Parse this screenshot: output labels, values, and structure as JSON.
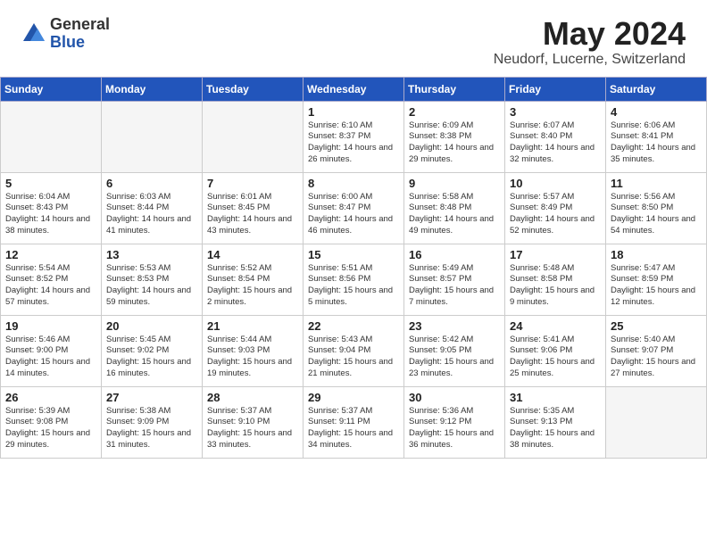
{
  "logo": {
    "general": "General",
    "blue": "Blue"
  },
  "title": {
    "month_year": "May 2024",
    "location": "Neudorf, Lucerne, Switzerland"
  },
  "weekdays": [
    "Sunday",
    "Monday",
    "Tuesday",
    "Wednesday",
    "Thursday",
    "Friday",
    "Saturday"
  ],
  "weeks": [
    [
      {
        "day": "",
        "info": ""
      },
      {
        "day": "",
        "info": ""
      },
      {
        "day": "",
        "info": ""
      },
      {
        "day": "1",
        "info": "Sunrise: 6:10 AM\nSunset: 8:37 PM\nDaylight: 14 hours\nand 26 minutes."
      },
      {
        "day": "2",
        "info": "Sunrise: 6:09 AM\nSunset: 8:38 PM\nDaylight: 14 hours\nand 29 minutes."
      },
      {
        "day": "3",
        "info": "Sunrise: 6:07 AM\nSunset: 8:40 PM\nDaylight: 14 hours\nand 32 minutes."
      },
      {
        "day": "4",
        "info": "Sunrise: 6:06 AM\nSunset: 8:41 PM\nDaylight: 14 hours\nand 35 minutes."
      }
    ],
    [
      {
        "day": "5",
        "info": "Sunrise: 6:04 AM\nSunset: 8:43 PM\nDaylight: 14 hours\nand 38 minutes."
      },
      {
        "day": "6",
        "info": "Sunrise: 6:03 AM\nSunset: 8:44 PM\nDaylight: 14 hours\nand 41 minutes."
      },
      {
        "day": "7",
        "info": "Sunrise: 6:01 AM\nSunset: 8:45 PM\nDaylight: 14 hours\nand 43 minutes."
      },
      {
        "day": "8",
        "info": "Sunrise: 6:00 AM\nSunset: 8:47 PM\nDaylight: 14 hours\nand 46 minutes."
      },
      {
        "day": "9",
        "info": "Sunrise: 5:58 AM\nSunset: 8:48 PM\nDaylight: 14 hours\nand 49 minutes."
      },
      {
        "day": "10",
        "info": "Sunrise: 5:57 AM\nSunset: 8:49 PM\nDaylight: 14 hours\nand 52 minutes."
      },
      {
        "day": "11",
        "info": "Sunrise: 5:56 AM\nSunset: 8:50 PM\nDaylight: 14 hours\nand 54 minutes."
      }
    ],
    [
      {
        "day": "12",
        "info": "Sunrise: 5:54 AM\nSunset: 8:52 PM\nDaylight: 14 hours\nand 57 minutes."
      },
      {
        "day": "13",
        "info": "Sunrise: 5:53 AM\nSunset: 8:53 PM\nDaylight: 14 hours\nand 59 minutes."
      },
      {
        "day": "14",
        "info": "Sunrise: 5:52 AM\nSunset: 8:54 PM\nDaylight: 15 hours\nand 2 minutes."
      },
      {
        "day": "15",
        "info": "Sunrise: 5:51 AM\nSunset: 8:56 PM\nDaylight: 15 hours\nand 5 minutes."
      },
      {
        "day": "16",
        "info": "Sunrise: 5:49 AM\nSunset: 8:57 PM\nDaylight: 15 hours\nand 7 minutes."
      },
      {
        "day": "17",
        "info": "Sunrise: 5:48 AM\nSunset: 8:58 PM\nDaylight: 15 hours\nand 9 minutes."
      },
      {
        "day": "18",
        "info": "Sunrise: 5:47 AM\nSunset: 8:59 PM\nDaylight: 15 hours\nand 12 minutes."
      }
    ],
    [
      {
        "day": "19",
        "info": "Sunrise: 5:46 AM\nSunset: 9:00 PM\nDaylight: 15 hours\nand 14 minutes."
      },
      {
        "day": "20",
        "info": "Sunrise: 5:45 AM\nSunset: 9:02 PM\nDaylight: 15 hours\nand 16 minutes."
      },
      {
        "day": "21",
        "info": "Sunrise: 5:44 AM\nSunset: 9:03 PM\nDaylight: 15 hours\nand 19 minutes."
      },
      {
        "day": "22",
        "info": "Sunrise: 5:43 AM\nSunset: 9:04 PM\nDaylight: 15 hours\nand 21 minutes."
      },
      {
        "day": "23",
        "info": "Sunrise: 5:42 AM\nSunset: 9:05 PM\nDaylight: 15 hours\nand 23 minutes."
      },
      {
        "day": "24",
        "info": "Sunrise: 5:41 AM\nSunset: 9:06 PM\nDaylight: 15 hours\nand 25 minutes."
      },
      {
        "day": "25",
        "info": "Sunrise: 5:40 AM\nSunset: 9:07 PM\nDaylight: 15 hours\nand 27 minutes."
      }
    ],
    [
      {
        "day": "26",
        "info": "Sunrise: 5:39 AM\nSunset: 9:08 PM\nDaylight: 15 hours\nand 29 minutes."
      },
      {
        "day": "27",
        "info": "Sunrise: 5:38 AM\nSunset: 9:09 PM\nDaylight: 15 hours\nand 31 minutes."
      },
      {
        "day": "28",
        "info": "Sunrise: 5:37 AM\nSunset: 9:10 PM\nDaylight: 15 hours\nand 33 minutes."
      },
      {
        "day": "29",
        "info": "Sunrise: 5:37 AM\nSunset: 9:11 PM\nDaylight: 15 hours\nand 34 minutes."
      },
      {
        "day": "30",
        "info": "Sunrise: 5:36 AM\nSunset: 9:12 PM\nDaylight: 15 hours\nand 36 minutes."
      },
      {
        "day": "31",
        "info": "Sunrise: 5:35 AM\nSunset: 9:13 PM\nDaylight: 15 hours\nand 38 minutes."
      },
      {
        "day": "",
        "info": ""
      }
    ]
  ]
}
